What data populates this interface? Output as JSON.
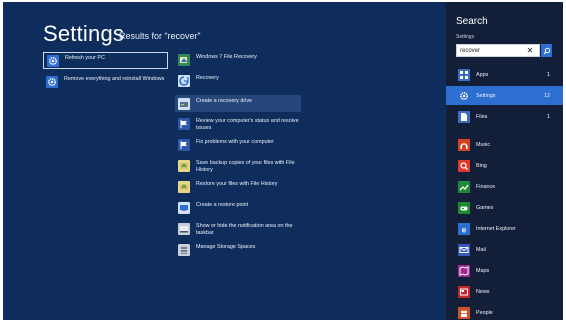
{
  "main": {
    "title": "Settings",
    "results_for": "Results for “recover”",
    "results_left": [
      {
        "label": "Refresh your PC",
        "icon": "gear-icon",
        "selected": true
      },
      {
        "label": "Remove everything and reinstall Windows",
        "icon": "gear-icon"
      }
    ],
    "results_right": [
      {
        "label": "Windows 7 File Recovery",
        "icon": "file-recovery-icon"
      },
      {
        "label": "Recovery",
        "icon": "recovery-icon"
      },
      {
        "label": "Create a recovery drive",
        "icon": "recovery-drive-icon",
        "hovered": true
      },
      {
        "label": "Review your computer's status and resolve issues",
        "icon": "action-center-flag-icon"
      },
      {
        "label": "Fix problems with your computer",
        "icon": "action-center-flag-icon"
      },
      {
        "label": "Save backup copies of your files with File History",
        "icon": "file-history-icon"
      },
      {
        "label": "Restore your files with File History",
        "icon": "file-history-icon"
      },
      {
        "label": "Create a restore point",
        "icon": "system-protection-icon"
      },
      {
        "label": "Show or hide the notification area on the taskbar",
        "icon": "taskbar-icon"
      },
      {
        "label": "Manage Storage Spaces",
        "icon": "storage-spaces-icon"
      }
    ]
  },
  "search": {
    "title": "Search",
    "scope": "Settings",
    "query": "recover",
    "clear_glyph": "✕",
    "scopes": [
      {
        "label": "Apps",
        "count": "1",
        "icon": "apps-icon",
        "color": "#3b6fc2"
      },
      {
        "label": "Settings",
        "count": "12",
        "icon": "gear-icon",
        "color": "#2c6fd0",
        "active": true
      },
      {
        "label": "Files",
        "count": "1",
        "icon": "files-icon",
        "color": "#3b6fc2"
      },
      {
        "label": "Music",
        "icon": "music-icon",
        "color": "#d4421f"
      },
      {
        "label": "Bing",
        "icon": "bing-icon",
        "color": "#e0382a"
      },
      {
        "label": "Finance",
        "icon": "finance-icon",
        "color": "#1f8a3a"
      },
      {
        "label": "Games",
        "icon": "games-icon",
        "color": "#1c8a2d"
      },
      {
        "label": "Internet Explorer",
        "icon": "internet-explorer-icon",
        "color": "#2a6fd0"
      },
      {
        "label": "Mail",
        "icon": "mail-icon",
        "color": "#3657b8"
      },
      {
        "label": "Maps",
        "icon": "maps-icon",
        "color": "#a0268f"
      },
      {
        "label": "News",
        "icon": "news-icon",
        "color": "#c4252e"
      },
      {
        "label": "People",
        "icon": "people-icon",
        "color": "#d0502a"
      }
    ]
  }
}
